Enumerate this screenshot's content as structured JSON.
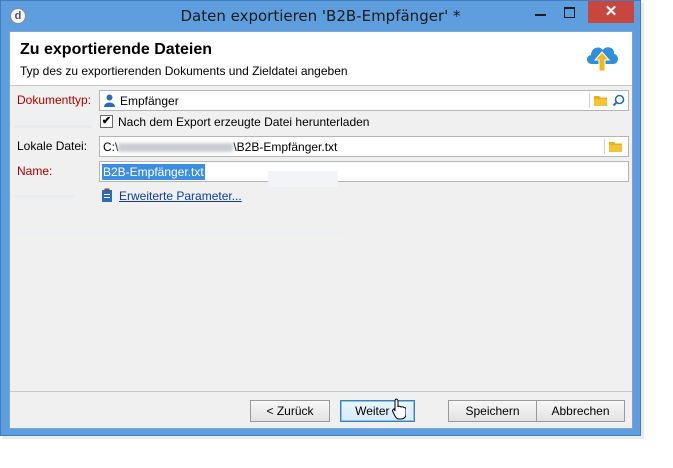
{
  "window": {
    "title": "Daten exportieren 'B2B-Empfänger' *",
    "close_glyph": "✕",
    "app_icon_glyph": "d"
  },
  "header": {
    "title": "Zu exportierende Dateien",
    "subtitle": "Typ des zu exportierenden Dokuments und Zieldatei angeben"
  },
  "form": {
    "doc_type_label": "Dokumenttyp:",
    "doc_type_value": "Empfänger",
    "download_checkbox_label": "Nach dem Export erzeugte Datei herunterladen",
    "download_checked": true,
    "local_file_label": "Lokale Datei:",
    "local_file_prefix": "C:\\",
    "local_file_suffix": "\\B2B-Empfänger.txt",
    "name_label": "Name:",
    "name_value": "B2B-Empfänger.txt",
    "advanced_link": "Erweiterte Parameter..."
  },
  "buttons": {
    "back": "< Zurück",
    "next": "Weiter >",
    "save": "Speichern",
    "cancel": "Abbrechen"
  },
  "colors": {
    "titlebar": "#5f9ede",
    "close_button": "#c7463e",
    "required_label": "#b00000",
    "link": "#0d3c9c",
    "selection": "#3d8ee0"
  },
  "icons": {
    "app": "app-logo-icon",
    "header": "cloud-upload-icon",
    "doc_type": "person-icon",
    "folder": "folder-icon",
    "search": "search-icon",
    "advanced": "clipboard-icon"
  }
}
